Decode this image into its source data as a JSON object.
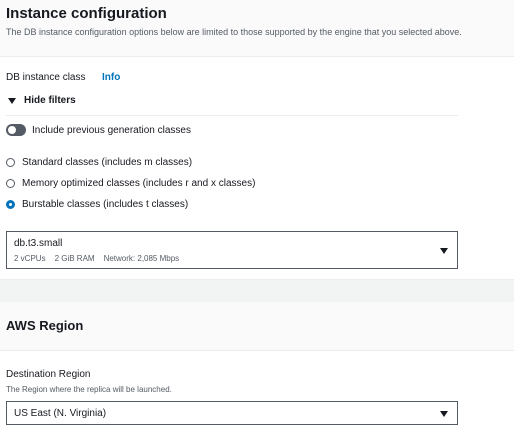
{
  "instance_config": {
    "title": "Instance configuration",
    "description": "The DB instance configuration options below are limited to those supported by the engine that you selected above.",
    "class_label": "DB instance class",
    "info_link": "Info",
    "hide_filters": "Hide filters",
    "toggle_label": "Include previous generation classes",
    "toggle_on": false,
    "radios": [
      {
        "label": "Standard classes (includes m classes)",
        "selected": false
      },
      {
        "label": "Memory optimized classes (includes r and x classes)",
        "selected": false
      },
      {
        "label": "Burstable classes (includes t classes)",
        "selected": true
      }
    ],
    "selected_instance": {
      "name": "db.t3.small",
      "vcpus": "2 vCPUs",
      "ram": "2 GiB RAM",
      "network": "Network: 2,085 Mbps"
    }
  },
  "region": {
    "title": "AWS Region",
    "destination_label": "Destination Region",
    "destination_desc": "The Region where the replica will be launched.",
    "selected": "US East (N. Virginia)"
  },
  "colors": {
    "link": "#0073bb",
    "radio_selected": "#0073bb",
    "toggle_off": "#545b64",
    "text": "#16191f",
    "muted": "#545b64"
  },
  "icons": {
    "filters_caret": "caret-down-icon",
    "dropdown": "dropdown-triangle-icon"
  }
}
